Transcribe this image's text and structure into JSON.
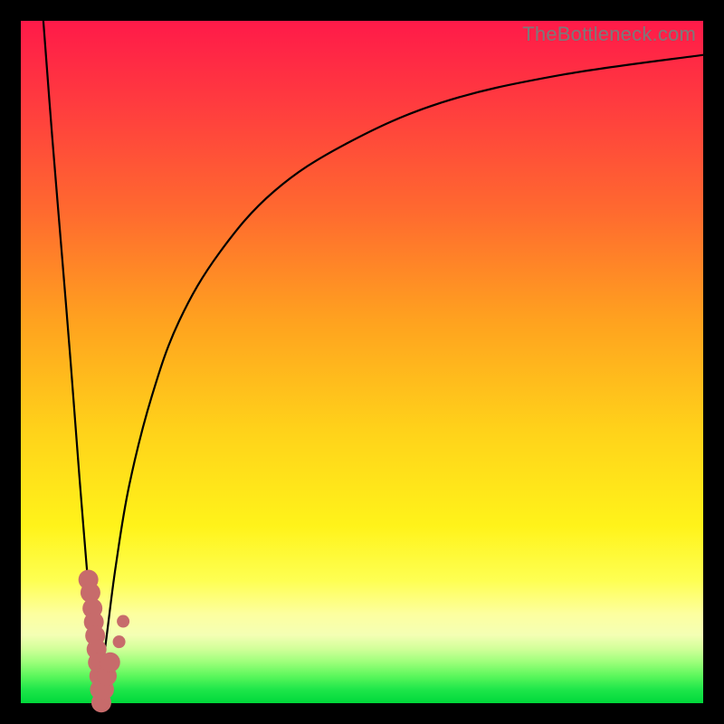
{
  "watermark": "TheBottleneck.com",
  "colors": {
    "frame": "#000000",
    "curve": "#000000",
    "marker": "#c76b6b",
    "gradient_top": "#ff1a49",
    "gradient_bottom": "#00d83a"
  },
  "chart_data": {
    "type": "line",
    "title": "",
    "xlabel": "",
    "ylabel": "",
    "xlim": [
      0,
      100
    ],
    "ylim": [
      0,
      100
    ],
    "series": [
      {
        "name": "left-branch",
        "x": [
          3.3,
          4.6,
          6.0,
          7.3,
          8.6,
          9.9,
          11.3
        ],
        "y": [
          100,
          83,
          66,
          50,
          33,
          17,
          0
        ]
      },
      {
        "name": "right-branch",
        "x": [
          11.3,
          12.6,
          13.9,
          15.9,
          19.2,
          23.2,
          29.1,
          37.1,
          47.7,
          61.6,
          78.8,
          100
        ],
        "y": [
          0,
          10,
          20,
          32,
          45,
          56,
          66,
          75,
          82,
          88,
          92,
          95
        ]
      }
    ],
    "markers": {
      "name": "highlight-cluster",
      "points": [
        {
          "x": 9.9,
          "y": 18.1,
          "r": 1.4
        },
        {
          "x": 10.2,
          "y": 16.2,
          "r": 1.4
        },
        {
          "x": 10.5,
          "y": 13.9,
          "r": 1.4
        },
        {
          "x": 10.7,
          "y": 11.9,
          "r": 1.4
        },
        {
          "x": 10.9,
          "y": 9.9,
          "r": 1.4
        },
        {
          "x": 11.1,
          "y": 7.9,
          "r": 1.4
        },
        {
          "x": 11.3,
          "y": 5.96,
          "r": 1.4
        },
        {
          "x": 11.5,
          "y": 4.0,
          "r": 1.4
        },
        {
          "x": 11.6,
          "y": 2.0,
          "r": 1.4
        },
        {
          "x": 11.8,
          "y": 0.1,
          "r": 1.4
        },
        {
          "x": 12.2,
          "y": 2.0,
          "r": 1.4
        },
        {
          "x": 12.6,
          "y": 4.0,
          "r": 1.4
        },
        {
          "x": 13.1,
          "y": 6.0,
          "r": 1.4
        },
        {
          "x": 14.4,
          "y": 9.0,
          "r": 0.9
        },
        {
          "x": 15.0,
          "y": 12.0,
          "r": 0.9
        }
      ]
    }
  }
}
